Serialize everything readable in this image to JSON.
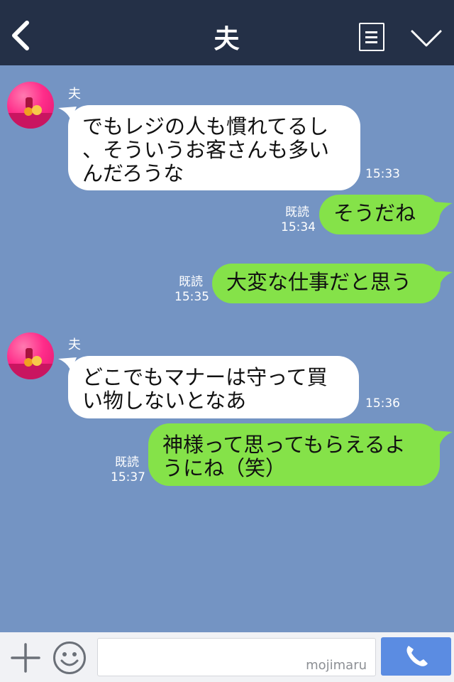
{
  "header": {
    "title": "夫",
    "back_icon": "chevron-left-icon",
    "menu_icon": "note-icon",
    "dropdown_icon": "chevron-down-icon",
    "bg_color": "#243047"
  },
  "chat": {
    "bg_color": "#7494c3",
    "incoming_color": "#ffffff",
    "outgoing_color": "#85e249",
    "messages": [
      {
        "direction": "incoming",
        "sender": "夫",
        "lines": [
          "でもレジの人も慣れてるし",
          "、そういうお客さんも多い",
          "んだろうな"
        ],
        "time": "15:33"
      },
      {
        "direction": "outgoing",
        "lines": [
          "そうだね"
        ],
        "read": "既読",
        "time": "15:34"
      },
      {
        "direction": "outgoing",
        "lines": [
          "大変な仕事だと思う"
        ],
        "read": "既読",
        "time": "15:35"
      },
      {
        "direction": "incoming",
        "sender": "夫",
        "lines": [
          "どこでもマナーは守って買",
          "い物しないとなあ"
        ],
        "time": "15:36"
      },
      {
        "direction": "outgoing",
        "lines": [
          "神様って思ってもらえるよ",
          "うにね（笑）"
        ],
        "read": "既読",
        "time": "15:37"
      }
    ]
  },
  "bottom_bar": {
    "plus_icon": "plus-icon",
    "emoji_icon": "smiley-icon",
    "input_value": "",
    "watermark": "mojimaru",
    "call_icon": "phone-icon",
    "call_color": "#5b8ce2"
  }
}
